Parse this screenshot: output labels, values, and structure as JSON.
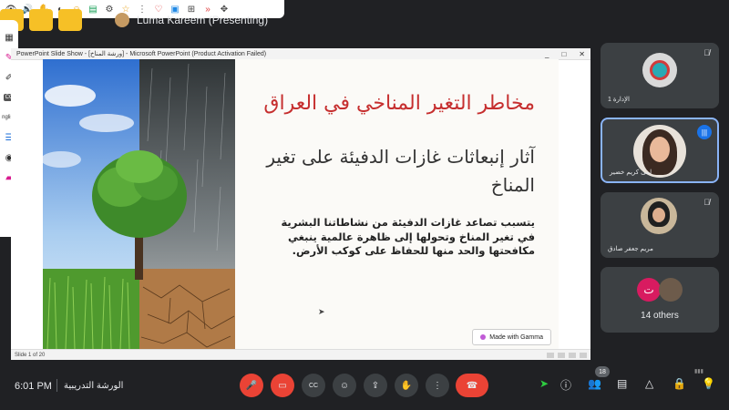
{
  "top_toolbar": {
    "icons": [
      "eye-icon",
      "volume-icon",
      "hand-icon",
      "mask-icon",
      "emoji-icon",
      "chat-icon",
      "gear-icon",
      "star-icon",
      "more-icon",
      "heart-icon",
      "pin-icon",
      "counter-icon",
      "forward-icon",
      "puzzle-icon"
    ]
  },
  "yellow_tiles": [
    "",
    "",
    ""
  ],
  "presenter": {
    "label": "Luma Kareem (Presenting)"
  },
  "annotation_toolbar": {
    "items": [
      "grid-icon",
      "pen-icon",
      "highlighter-icon",
      "cc-icon",
      "language-label",
      "list-icon",
      "camera-icon",
      "screen-icon"
    ],
    "cc": "CC",
    "language": "nglish"
  },
  "window": {
    "title": "PowerPoint Slide Show - [ورشة المناخ] - Microsoft PowerPoint (Product Activation Failed)",
    "controls": [
      "_",
      "□",
      "✕"
    ],
    "status": "Slide 1 of 20"
  },
  "slide": {
    "title": "مخاطر التغير المناخي في العراق",
    "heading": "آثار إنبعاثات غازات الدفيئة على تغير المناخ",
    "body": "يتسبب تصاعد غازات الدفيئة من نشاطاتنا البشرية في تغير المناخ وتحولها إلى ظاهرة عالمية ينبغي مكافحتها والحد منها للحفاظ على كوكب الأرض.",
    "badge": "Made with Gamma"
  },
  "participants": [
    {
      "name": "الإدارة 1",
      "mic": "muted"
    },
    {
      "name": "لمى كريم خضير",
      "mic": "speaking"
    },
    {
      "name": "مريم جعفر صادق",
      "mic": "muted"
    }
  ],
  "others": {
    "label": "14 others",
    "initial": "ت"
  },
  "bottom_bar": {
    "time": "6:01 PM",
    "meeting_name": "الورشة التدريبية",
    "controls": [
      "mic-off-icon",
      "camera-off-icon",
      "captions-icon",
      "emoji-icon",
      "present-icon",
      "raise-hand-icon",
      "more-icon",
      "end-call-icon"
    ],
    "cc_label": "CC",
    "participant_count": "18"
  },
  "colors": {
    "background": "#202124",
    "tile": "#3c4043",
    "accent_blue": "#8ab4f8",
    "end_call_red": "#ea4335",
    "slide_title_red": "#c62f2f"
  }
}
